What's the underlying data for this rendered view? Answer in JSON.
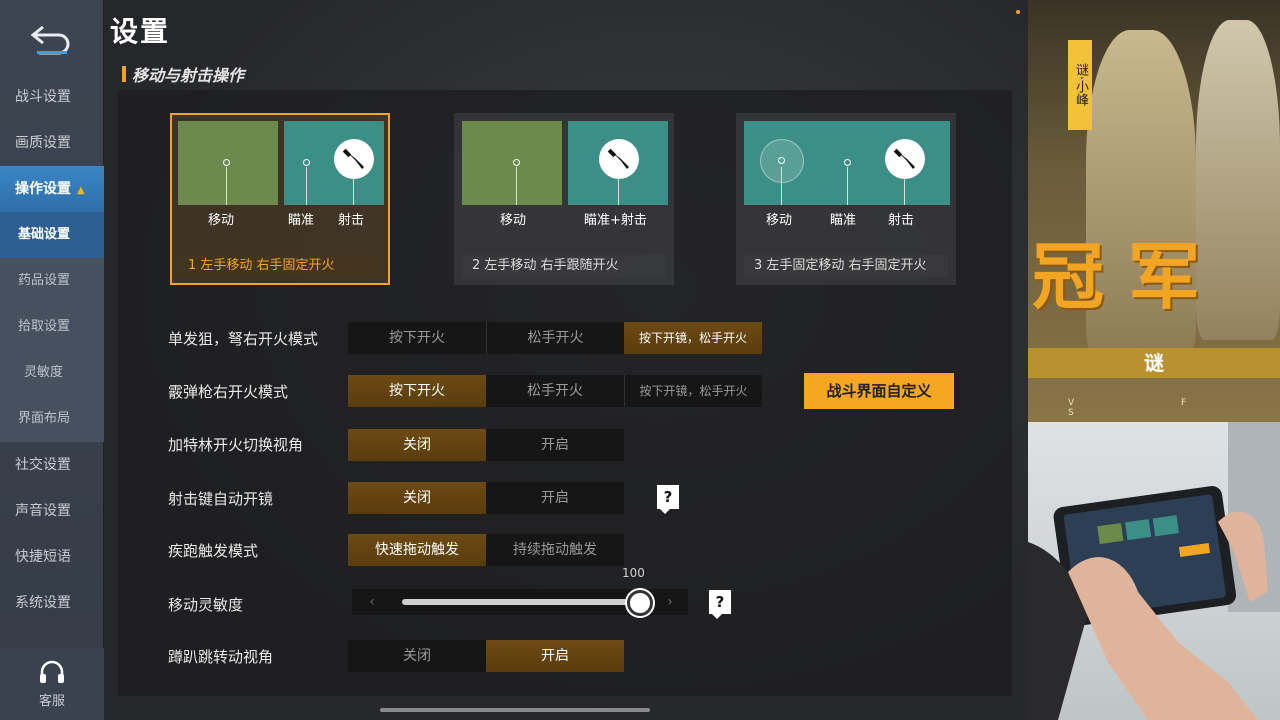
{
  "sidebar": {
    "items": [
      {
        "label": "战斗设置"
      },
      {
        "label": "画质设置"
      },
      {
        "label": "操作设置"
      },
      {
        "label": "基础设置"
      },
      {
        "label": "药品设置"
      },
      {
        "label": "拾取设置"
      },
      {
        "label": "灵敏度"
      },
      {
        "label": "界面布局"
      },
      {
        "label": "社交设置"
      },
      {
        "label": "声音设置"
      },
      {
        "label": "快捷短语"
      },
      {
        "label": "系统设置"
      }
    ],
    "service_label": "客服"
  },
  "main": {
    "title": "设置",
    "section_title": "移动与射击操作",
    "modes": [
      {
        "labels": [
          "移动",
          "瞄准",
          "射击"
        ],
        "caption": "1 左手移动 右手固定开火",
        "selected": true
      },
      {
        "labels": [
          "移动",
          "瞄准+射击"
        ],
        "caption": "2 左手移动 右手跟随开火",
        "selected": false
      },
      {
        "labels": [
          "移动",
          "瞄准",
          "射击"
        ],
        "caption": "3 左手固定移动 右手固定开火",
        "selected": false
      }
    ],
    "settings": [
      {
        "label": "单发狙，弩右开火模式",
        "options": [
          "按下开火",
          "松手开火",
          "按下开镜，松手开火"
        ],
        "selected": 2
      },
      {
        "label": "霰弹枪右开火模式",
        "options": [
          "按下开火",
          "松手开火",
          "按下开镜，松手开火"
        ],
        "selected": 0
      },
      {
        "label": "加特林开火切换视角",
        "options": [
          "关闭",
          "开启"
        ],
        "selected": 0
      },
      {
        "label": "射击键自动开镜",
        "options": [
          "关闭",
          "开启"
        ],
        "selected": 0
      },
      {
        "label": "疾跑触发模式",
        "options": [
          "快速拖动触发",
          "持续拖动触发"
        ],
        "selected": 0
      },
      {
        "label": "蹲趴跳转动视角",
        "options": [
          "关闭",
          "开启"
        ],
        "selected": 1
      }
    ],
    "move_sensitivity": {
      "label": "移动灵敏度",
      "value": 100,
      "value_text": "100",
      "min": 0,
      "max": 100
    },
    "custom_button": "战斗界面自定义",
    "help_glyph": "?",
    "arrow_left": "‹",
    "arrow_right": "›"
  },
  "poster": {
    "vertical_text": "谜·小峰",
    "big_text": "冠军",
    "tag": "谜",
    "letters": "V F S"
  },
  "colors": {
    "accent": "#f2a523",
    "sidebar_active": "#3a86c7",
    "toggle_on": "#6e4a12",
    "green_zone": "#6c8a4b",
    "teal_zone": "#3c8f86"
  }
}
